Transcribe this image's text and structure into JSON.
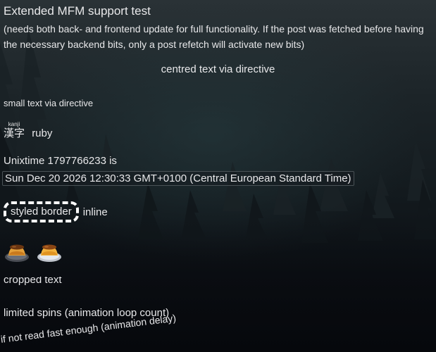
{
  "post": {
    "title": "Extended MFM support test",
    "note": "(needs both back- and frontend update for full functionality. If the post was fetched before having the necessary backend bits, only a post refetch will activate new bits)",
    "centred_text": "centred text via directive",
    "small_text": "small text via directive",
    "ruby": {
      "base": "漢字",
      "annotation": "kanji",
      "after": "ruby"
    },
    "unixtime_label": "Unixtime 1797766233 is",
    "unixtime_value": "Sun Dec 20 2026 12:30:33 GMT+0100 (Central European Standard Time)",
    "styled_border_text": "styled border",
    "inline_label": "inline",
    "emoji": [
      "pudding-emoji",
      "pudding-emoji"
    ],
    "cropped_text": "cropped text",
    "limited_spins": "limited spins (animation loop count)",
    "delay_text": "if not read fast enough (animation delay)"
  },
  "colors": {
    "text": "#e8e8ea",
    "background_dark": "#07090d",
    "background_teal": "#283e42",
    "border_white": "#ffffff"
  }
}
